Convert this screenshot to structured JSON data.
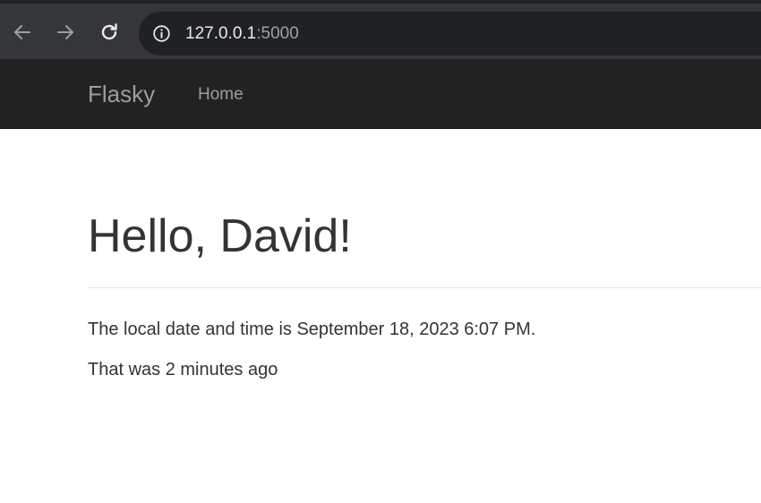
{
  "browser": {
    "url_host": "127.0.0.1",
    "url_port": ":5000",
    "icons": {
      "back": "arrow-left-icon",
      "forward": "arrow-right-icon",
      "reload": "reload-icon",
      "site_info": "info-circle-icon"
    }
  },
  "navbar": {
    "brand": "Flasky",
    "items": [
      {
        "label": "Home"
      }
    ]
  },
  "main": {
    "heading": "Hello, David!",
    "time_line": "The local date and time is September 18, 2023 6:07 PM.",
    "ago_line": "That was 2 minutes ago"
  },
  "colors": {
    "toolbar_bg": "#35363a",
    "omnibox_bg": "#202124",
    "navbar_bg": "#222222",
    "navbar_text": "#9d9d9d",
    "body_text": "#333333"
  }
}
